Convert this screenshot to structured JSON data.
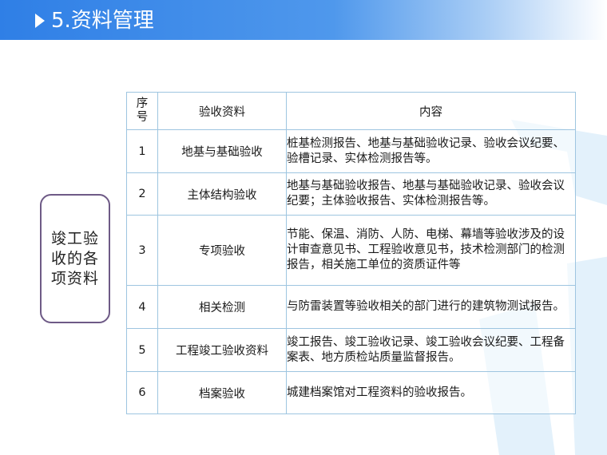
{
  "header": {
    "title": "5.资料管理",
    "arrow_icon": "play-triangle-icon",
    "colors": {
      "bar": "#2f7fe6",
      "text": "#ffffff"
    }
  },
  "side_label": {
    "text": "竣工验收的各项资料",
    "border_color": "#6e5a86"
  },
  "table": {
    "headers": {
      "no": "序号",
      "item": "验收资料",
      "content": "内容"
    },
    "border_color": "#9ec5e0",
    "rows": [
      {
        "no": "1",
        "item": "地基与基础验收",
        "content": "桩基检测报告、地基与基础验收记录、验收会议纪要、验槽记录、实体检测报告等。"
      },
      {
        "no": "2",
        "item": "主体结构验收",
        "content": "地基与基础验收报告、地基与基础验收记录、验收会议纪要；主体验收报告、实体检测报告等。"
      },
      {
        "no": "3",
        "item": "专项验收",
        "content": "节能、保温、消防、人防、电梯、幕墙等验收涉及的设计审查意见书、工程验收意见书，技术检测部门的检测报告，相关施工单位的资质证件等"
      },
      {
        "no": "4",
        "item": "相关检测",
        "content": "与防雷装置等验收相关的部门进行的建筑物测试报告。"
      },
      {
        "no": "5",
        "item": "工程竣工验收资料",
        "content": "竣工报告、竣工验收记录、竣工验收会议纪要、工程备案表、地方质检站质量监督报告。"
      },
      {
        "no": "6",
        "item": "档案验收",
        "content": "城建档案馆对工程资料的验收报告。"
      }
    ]
  }
}
